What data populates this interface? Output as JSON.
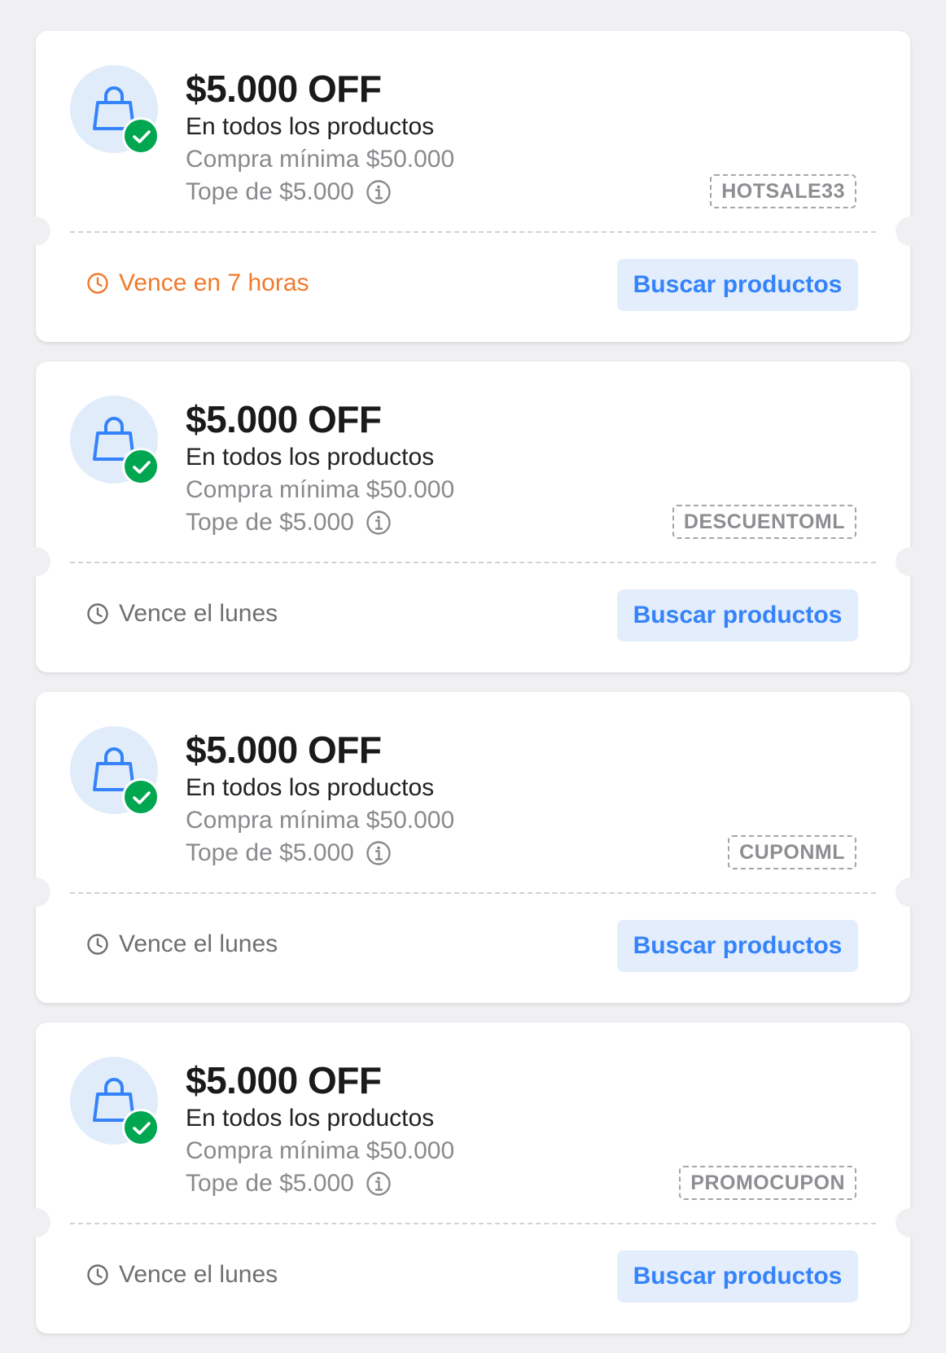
{
  "colors": {
    "page_background": "#f0f0f2",
    "card_background": "#ffffff",
    "accent_blue": "#3483fa",
    "button_background": "#e3edfb",
    "success_green": "#00a650",
    "urgent_orange": "#f07a2c",
    "muted_text": "#8a8a8e"
  },
  "icons": {
    "coupon_icon": "shopping-bag-icon",
    "badge_icon": "checkmark-icon",
    "info_icon": "info-icon",
    "expiry_icon": "clock-icon"
  },
  "coupons": [
    {
      "amount": "$5.000 OFF",
      "scope": "En todos los productos",
      "min_purchase": "Compra mínima $50.000",
      "cap": "Tope de $5.000",
      "code": "HOTSALE33",
      "expiry": "Vence en 7 horas",
      "expiry_urgent": true,
      "button_label": "Buscar productos"
    },
    {
      "amount": "$5.000 OFF",
      "scope": "En todos los productos",
      "min_purchase": "Compra mínima $50.000",
      "cap": "Tope de $5.000",
      "code": "DESCUENTOML",
      "expiry": "Vence el lunes",
      "expiry_urgent": false,
      "button_label": "Buscar productos"
    },
    {
      "amount": "$5.000 OFF",
      "scope": "En todos los productos",
      "min_purchase": "Compra mínima $50.000",
      "cap": "Tope de $5.000",
      "code": "CUPONML",
      "expiry": "Vence el lunes",
      "expiry_urgent": false,
      "button_label": "Buscar productos"
    },
    {
      "amount": "$5.000 OFF",
      "scope": "En todos los productos",
      "min_purchase": "Compra mínima $50.000",
      "cap": "Tope de $5.000",
      "code": "PROMOCUPON",
      "expiry": "Vence el lunes",
      "expiry_urgent": false,
      "button_label": "Buscar productos"
    }
  ]
}
